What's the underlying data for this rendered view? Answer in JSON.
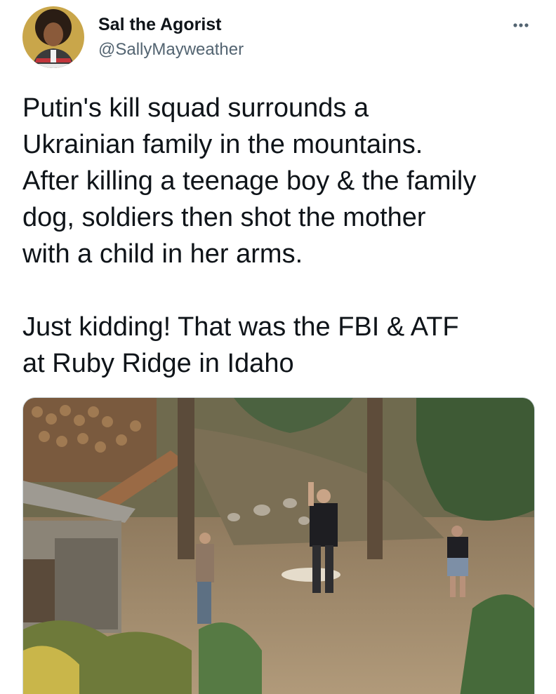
{
  "author": {
    "display_name": "Sal the Agorist",
    "handle": "@SallyMayweather",
    "avatar_icon": "profile-photo"
  },
  "more_icon": "more-horizontal-icon",
  "tweet": {
    "paragraphs": [
      "Putin's kill squad surrounds a\nUkrainian family in the mountains.\nAfter killing a teenage boy & the family\ndog, soldiers then shot the mother\nwith a child in her arms.",
      "Just kidding! That was the FBI & ATF\nat Ruby Ridge in Idaho"
    ]
  },
  "media": {
    "type": "photo"
  },
  "colors": {
    "text": "#0f1419",
    "secondary_text": "#536471",
    "border": "#cfd9de"
  }
}
